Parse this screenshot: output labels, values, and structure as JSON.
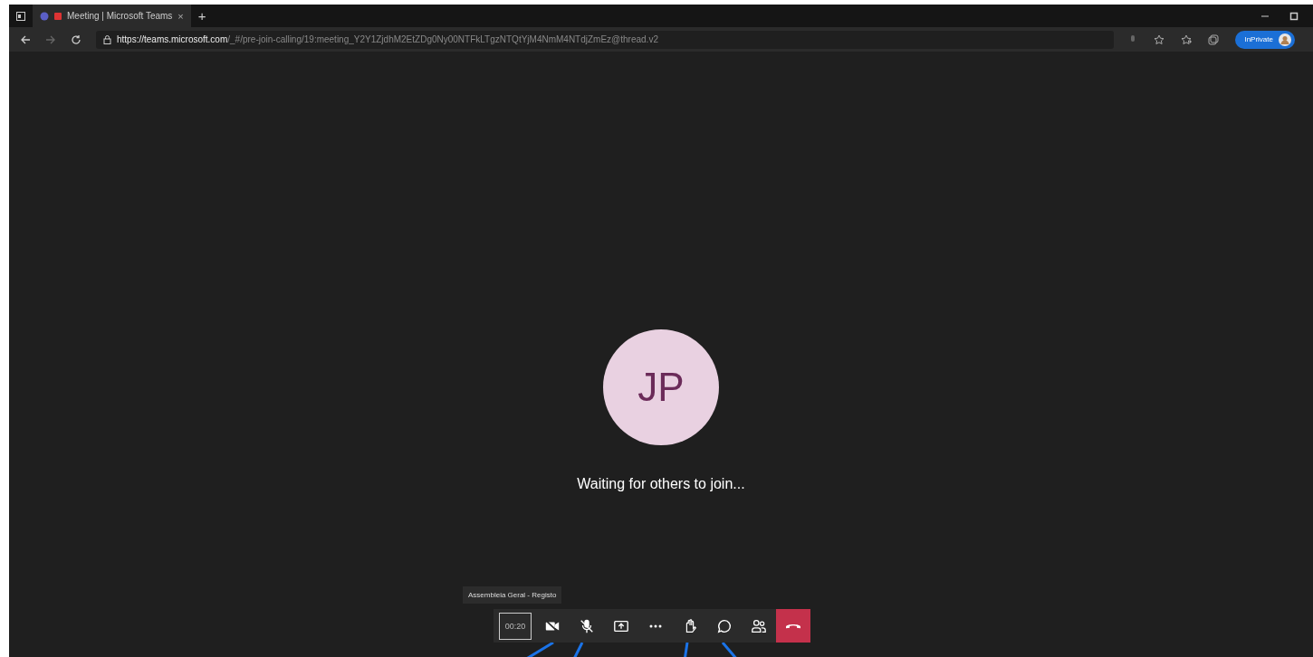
{
  "browser": {
    "tab": {
      "title": "Meeting | Microsoft Teams",
      "close": "×"
    },
    "new_tab": "+",
    "url_host": "https://teams.microsoft.com",
    "url_path": "/_#/pre-join-calling/19:meeting_Y2Y1ZjdhM2EtZDg0Ny00NTFkLTgzNTQtYjM4NmM4NTdjZmEz@thread.v2",
    "inprivate": "InPrivate"
  },
  "call": {
    "avatar_initials": "JP",
    "status": "Waiting for others to join...",
    "tooltip": "Assembleia Geral - Registo",
    "timer": "00:20",
    "controls": [
      {
        "kind": "camera-off"
      },
      {
        "kind": "mic-off"
      },
      {
        "kind": "share"
      },
      {
        "kind": "more"
      },
      {
        "kind": "hand"
      },
      {
        "kind": "chat"
      },
      {
        "kind": "people"
      },
      {
        "kind": "hangup"
      }
    ]
  }
}
